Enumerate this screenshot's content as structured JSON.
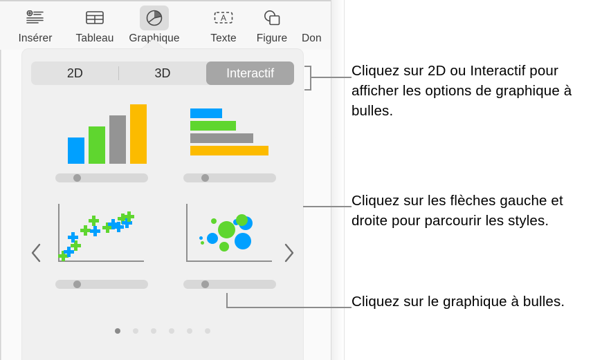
{
  "toolbar": {
    "items": [
      {
        "label": "Insérer",
        "icon": "insert-icon",
        "active": false
      },
      {
        "label": "Tableau",
        "icon": "table-icon",
        "active": false
      },
      {
        "label": "Graphique",
        "icon": "chart-pie-icon",
        "active": true
      },
      {
        "label": "Texte",
        "icon": "text-box-icon",
        "active": false
      },
      {
        "label": "Figure",
        "icon": "shapes-icon",
        "active": false
      },
      {
        "label": "Don",
        "icon": "media-icon",
        "active": false
      }
    ]
  },
  "popover": {
    "segments": [
      {
        "label": "2D",
        "selected": false
      },
      {
        "label": "3D",
        "selected": false
      },
      {
        "label": "Interactif",
        "selected": true
      }
    ],
    "nav": {
      "prev_label": "‹",
      "next_label": "›"
    },
    "page_dots": {
      "count": 6,
      "active_index": 0
    },
    "thumbnails": [
      {
        "name": "interactive-column-chart",
        "type": "column",
        "colors": [
          "#00a0ff",
          "#5fd62f",
          "#949494",
          "#fcbb00"
        ],
        "values": [
          40,
          58,
          74,
          90
        ],
        "slider_value": 22
      },
      {
        "name": "interactive-bar-chart",
        "type": "bar",
        "colors": [
          "#00a0ff",
          "#5fd62f",
          "#949494",
          "#fcbb00"
        ],
        "values": [
          42,
          62,
          80,
          100
        ],
        "slider_value": 22
      },
      {
        "name": "interactive-scatter-chart",
        "type": "scatter",
        "colors": [
          "#00a0ff",
          "#5fd62f"
        ],
        "slider_value": 22
      },
      {
        "name": "interactive-bubble-chart",
        "type": "bubble",
        "colors": [
          "#00a0ff",
          "#5fd62f"
        ],
        "slider_value": 22
      }
    ]
  },
  "callouts": [
    {
      "text": "Cliquez sur 2D ou Interactif pour afficher les options de graphique à bulles."
    },
    {
      "text": "Cliquez sur les flèches gauche et droite pour parcourir les styles."
    },
    {
      "text": "Cliquez sur le graphique à bulles."
    }
  ],
  "colors": {
    "blue": "#00a0ff",
    "green": "#5fd62f",
    "gray": "#949494",
    "amber": "#fcbb00",
    "selected_segment": "#a6a6a6",
    "popover_bg": "#f0f0f0",
    "leader": "#8c8c8c"
  }
}
